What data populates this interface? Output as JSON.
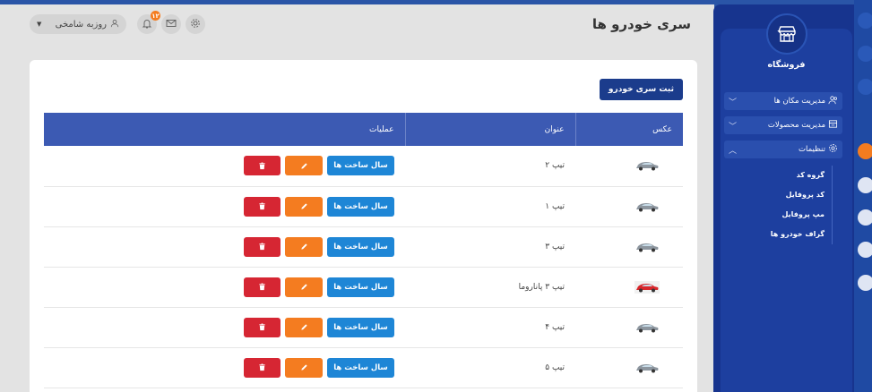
{
  "header": {
    "page_title": "سری خودرو ها",
    "user_name": "روزبه شامخی",
    "notification_count": "۱۲"
  },
  "card": {
    "add_button": "ثبت سری خودرو",
    "table": {
      "columns": [
        "عکس",
        "عنوان",
        "عملیات"
      ],
      "rows": [
        {
          "title": "تیپ ۲",
          "car_color": "gray"
        },
        {
          "title": "تیپ ۱",
          "car_color": "gray"
        },
        {
          "title": "تیپ ۳",
          "car_color": "gray"
        },
        {
          "title": "تیپ ۳ پاناروما",
          "car_color": "red"
        },
        {
          "title": "تیپ ۴",
          "car_color": "gray"
        },
        {
          "title": "تیپ ۵",
          "car_color": "gray"
        }
      ],
      "year_button": "سال ساخت ها"
    }
  },
  "sidebar": {
    "store_name": "فروشگاه",
    "menu": [
      {
        "label": "مدیریت مکان ها",
        "icon": "users-icon"
      },
      {
        "label": "مدیریت محصولات",
        "icon": "store-icon"
      },
      {
        "label": "تنظیمات",
        "icon": "gear-icon"
      }
    ],
    "submenu": [
      "گروه کد",
      "کد پروفایل",
      "مپ پروفایل",
      "گراف خودرو ها"
    ]
  },
  "colors": {
    "primary": "#1b3c8c",
    "table_header": "#3c5ab3",
    "year": "#1e86d6",
    "edit": "#f47c20",
    "delete": "#d62633"
  }
}
